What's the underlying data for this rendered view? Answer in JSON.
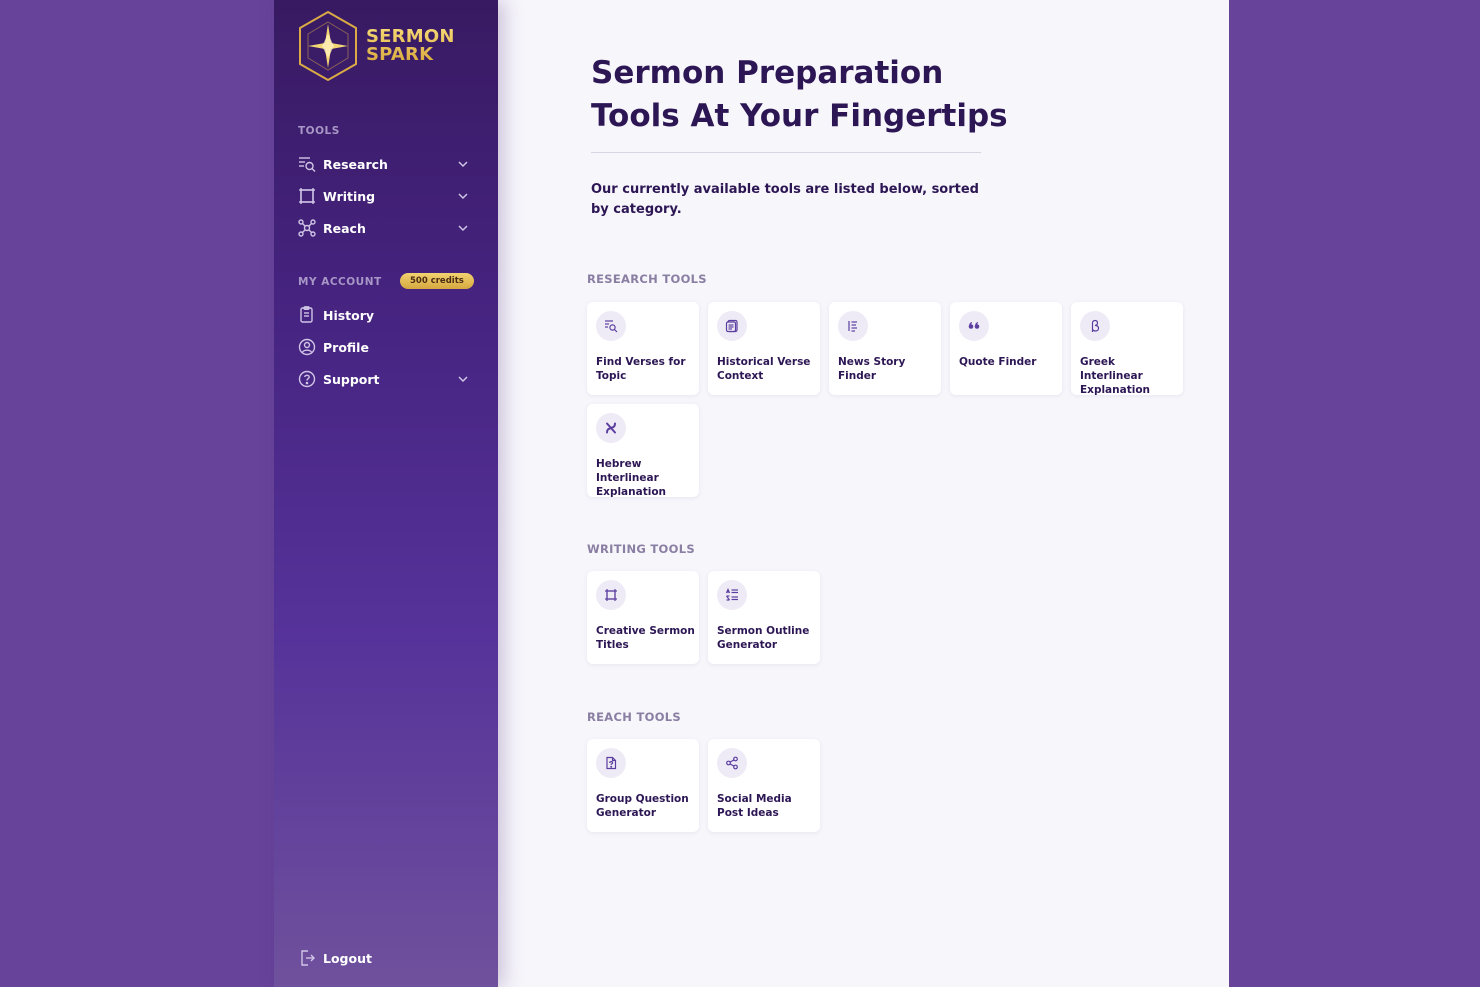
{
  "brand": {
    "line1": "SERMON",
    "line2": "SPARK"
  },
  "sidebar": {
    "tools_label": "TOOLS",
    "tools": [
      {
        "label": "Research",
        "icon": "research-icon"
      },
      {
        "label": "Writing",
        "icon": "writing-icon"
      },
      {
        "label": "Reach",
        "icon": "reach-icon"
      }
    ],
    "account_label": "MY ACCOUNT",
    "credits": "500 credits",
    "account": [
      {
        "label": "History",
        "icon": "history-icon"
      },
      {
        "label": "Profile",
        "icon": "profile-icon"
      },
      {
        "label": "Support",
        "icon": "support-icon"
      }
    ],
    "logout": "Logout"
  },
  "main": {
    "title": "Sermon Preparation Tools At Your Fingertips",
    "intro": "Our currently available tools are listed below, sorted by category.",
    "categories": [
      {
        "label": "RESEARCH TOOLS",
        "tools": [
          {
            "label": "Find Verses for Topic",
            "icon": "search-list-icon"
          },
          {
            "label": "Historical Verse Context",
            "icon": "document-icon"
          },
          {
            "label": "News Story Finder",
            "icon": "list-lines-icon"
          },
          {
            "label": "Quote Finder",
            "icon": "quote-icon"
          },
          {
            "label": "Greek Interlinear Explanation",
            "icon": "beta-icon"
          },
          {
            "label": "Hebrew Interlinear Explanation",
            "icon": "aleph-icon"
          }
        ]
      },
      {
        "label": "WRITING TOOLS",
        "tools": [
          {
            "label": "Creative Sermon Titles",
            "icon": "frame-icon"
          },
          {
            "label": "Sermon Outline Generator",
            "icon": "outline-icon"
          }
        ]
      },
      {
        "label": "REACH TOOLS",
        "tools": [
          {
            "label": "Group Question Generator",
            "icon": "question-doc-icon"
          },
          {
            "label": "Social Media Post Ideas",
            "icon": "share-icon"
          }
        ]
      }
    ]
  },
  "colors": {
    "background": "#68439a",
    "sidebar_top": "#381a62",
    "sidebar_bottom": "#6f519d",
    "accent_gold": "#e0b850",
    "text_dark": "#2c1654"
  }
}
